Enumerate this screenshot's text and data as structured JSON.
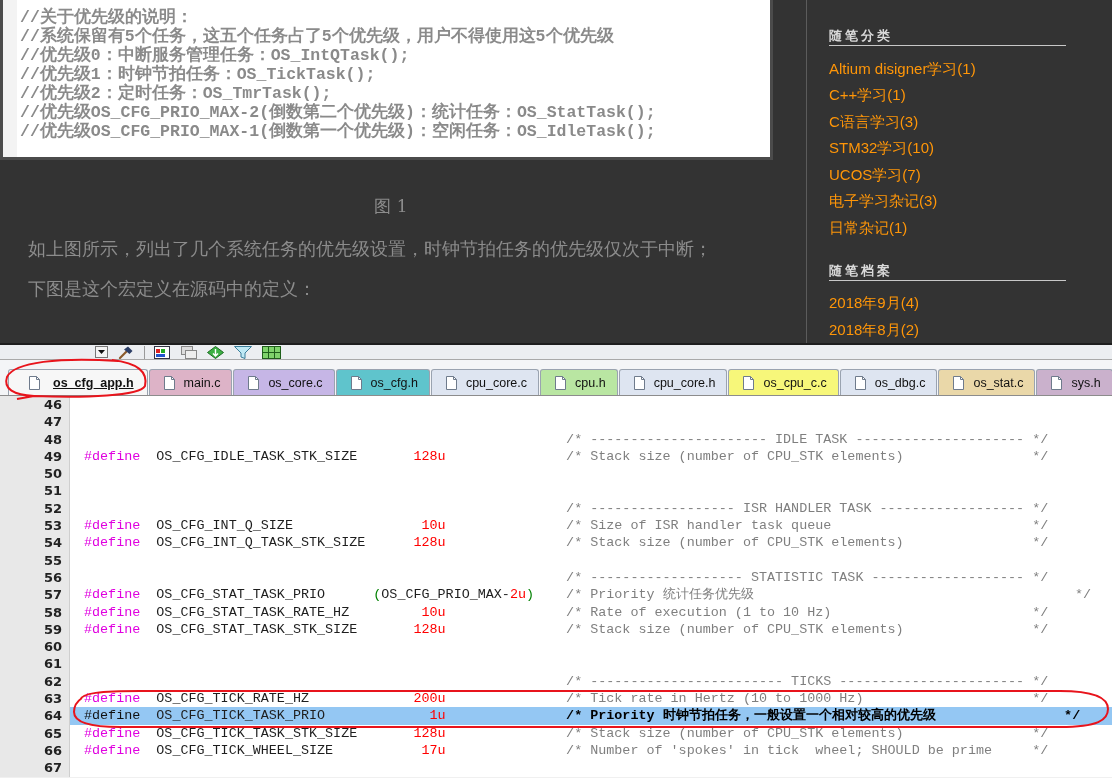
{
  "article": {
    "code_image": {
      "lines": [
        "//关于优先级的说明：",
        "//系统保留有5个任务，这五个任务占了5个优先级，用户不得使用这5个优先级",
        "//优先级0：中断服务管理任务：OS_IntQTask();",
        "//优先级1：时钟节拍任务：OS_TickTask();",
        "//优先级2：定时任务：OS_TmrTask();",
        "//优先级OS_CFG_PRIO_MAX-2(倒数第二个优先级)：统计任务：OS_StatTask();",
        "//优先级OS_CFG_PRIO_MAX-1(倒数第一个优先级)：空闲任务：OS_IdleTask();"
      ]
    },
    "caption": "图 1",
    "paragraphs": [
      "如上图所示，列出了几个系统任务的优先级设置，时钟节拍任务的优先级仅次于中断；",
      "下图是这个宏定义在源码中的定义："
    ]
  },
  "sidebar": {
    "categories": {
      "title": "随笔分类",
      "items": [
        "Altium disigner学习(1)",
        "C++学习(1)",
        "C语言学习(3)",
        "STM32学习(10)",
        "UCOS学习(7)",
        "电子学习杂记(3)",
        "日常杂记(1)"
      ]
    },
    "archives": {
      "title": "随笔档案",
      "items": [
        "2018年9月(4)",
        "2018年8月(2)"
      ]
    }
  },
  "editor": {
    "tabs": [
      {
        "label": "os_cfg_app.h",
        "selected": true,
        "color": "#f7f7f7"
      },
      {
        "label": "main.c",
        "selected": false,
        "color": "#ddb3c7"
      },
      {
        "label": "os_core.c",
        "selected": false,
        "color": "#c6b6e6"
      },
      {
        "label": "os_cfg.h",
        "selected": false,
        "color": "#5fc4cc"
      },
      {
        "label": "cpu_core.c",
        "selected": false,
        "color": "#dee5f1"
      },
      {
        "label": "cpu.h",
        "selected": false,
        "color": "#b9e6a2"
      },
      {
        "label": "cpu_core.h",
        "selected": false,
        "color": "#dee5f1"
      },
      {
        "label": "os_cpu_c.c",
        "selected": false,
        "color": "#f7f77a"
      },
      {
        "label": "os_dbg.c",
        "selected": false,
        "color": "#dee5f1"
      },
      {
        "label": "os_stat.c",
        "selected": false,
        "color": "#ead8a9"
      },
      {
        "label": "sys.h",
        "selected": false,
        "color": "#cab1cc"
      }
    ],
    "lines": [
      {
        "number": "46",
        "highlighted": false
      },
      {
        "number": "47",
        "highlighted": false
      },
      {
        "number": "48",
        "highlighted": false,
        "comment": "/* ---------------------- IDLE TASK --------------------- */"
      },
      {
        "number": "49",
        "highlighted": false,
        "keyword": "#define",
        "name": "OS_CFG_IDLE_TASK_STK_SIZE",
        "value": [
          {
            "kind": "number",
            "text": "128u"
          }
        ],
        "comment": "/* Stack size (number of CPU_STK elements)                */"
      },
      {
        "number": "50",
        "highlighted": false
      },
      {
        "number": "51",
        "highlighted": false
      },
      {
        "number": "52",
        "highlighted": false,
        "comment": "/* ------------------ ISR HANDLER TASK ------------------ */"
      },
      {
        "number": "53",
        "highlighted": false,
        "keyword": "#define",
        "name": "OS_CFG_INT_Q_SIZE",
        "value": [
          {
            "kind": "number",
            "text": "10u"
          }
        ],
        "comment": "/* Size of ISR handler task queue                         */"
      },
      {
        "number": "54",
        "highlighted": false,
        "keyword": "#define",
        "name": "OS_CFG_INT_Q_TASK_STK_SIZE",
        "value": [
          {
            "kind": "number",
            "text": "128u"
          }
        ],
        "comment": "/* Stack size (number of CPU_STK elements)                */"
      },
      {
        "number": "55",
        "highlighted": false
      },
      {
        "number": "56",
        "highlighted": false,
        "comment": "/* ------------------- STATISTIC TASK ------------------- */"
      },
      {
        "number": "57",
        "highlighted": false,
        "keyword": "#define",
        "name": "OS_CFG_STAT_TASK_PRIO",
        "value": [
          {
            "kind": "paren",
            "text": "("
          },
          {
            "kind": "ident",
            "text": "OS_CFG_PRIO_MAX-"
          },
          {
            "kind": "number",
            "text": "2u"
          },
          {
            "kind": "paren",
            "text": ")"
          }
        ],
        "comment": "/* Priority 统计任务优先级                                        */"
      },
      {
        "number": "58",
        "highlighted": false,
        "keyword": "#define",
        "name": "OS_CFG_STAT_TASK_RATE_HZ",
        "value": [
          {
            "kind": "number",
            "text": "10u"
          }
        ],
        "comment": "/* Rate of execution (1 to 10 Hz)                         */"
      },
      {
        "number": "59",
        "highlighted": false,
        "keyword": "#define",
        "name": "OS_CFG_STAT_TASK_STK_SIZE",
        "value": [
          {
            "kind": "number",
            "text": "128u"
          }
        ],
        "comment": "/* Stack size (number of CPU_STK elements)                */"
      },
      {
        "number": "60",
        "highlighted": false
      },
      {
        "number": "61",
        "highlighted": false
      },
      {
        "number": "62",
        "highlighted": false,
        "comment": "/* ------------------------ TICKS ----------------------- */"
      },
      {
        "number": "63",
        "highlighted": false,
        "keyword": "#define",
        "name": "OS_CFG_TICK_RATE_HZ",
        "value": [
          {
            "kind": "number",
            "text": "200u"
          }
        ],
        "comment": "/* Tick rate in Hertz (10 to 1000 Hz)                     */"
      },
      {
        "number": "64",
        "highlighted": true,
        "keyword": "#define",
        "name": "OS_CFG_TICK_TASK_PRIO",
        "value": [
          {
            "kind": "number",
            "text": "1u"
          }
        ],
        "comment": "/* Priority 时钟节拍任务，一般设置一个相对较高的优先级                */"
      },
      {
        "number": "65",
        "highlighted": false,
        "keyword": "#define",
        "name": "OS_CFG_TICK_TASK_STK_SIZE",
        "value": [
          {
            "kind": "number",
            "text": "128u"
          }
        ],
        "comment": "/* Stack size (number of CPU_STK elements)                */"
      },
      {
        "number": "66",
        "highlighted": false,
        "keyword": "#define",
        "name": "OS_CFG_TICK_WHEEL_SIZE",
        "value": [
          {
            "kind": "number",
            "text": "17u"
          }
        ],
        "comment": "/* Number of 'spokes' in tick  wheel; SHOULD be prime     */"
      },
      {
        "number": "67",
        "highlighted": false
      }
    ]
  }
}
